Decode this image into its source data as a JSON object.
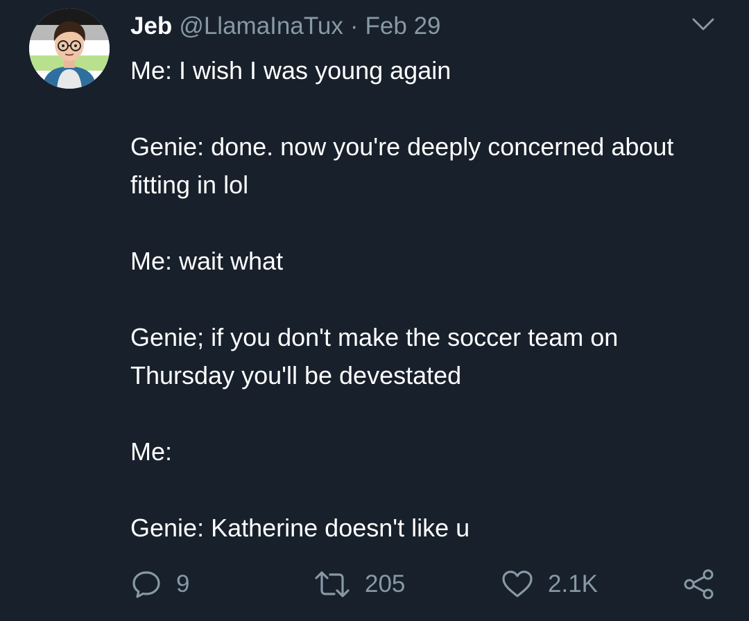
{
  "tweet": {
    "author": {
      "display_name": "Jeb",
      "handle": "@LlamaInaTux"
    },
    "separator": "·",
    "date": "Feb 29",
    "paragraphs": [
      "Me: I wish I was young again",
      "Genie: done. now you're deeply concerned about fitting in lol",
      "Me: wait what",
      "Genie; if you don't make the soccer team on Thursday you'll be devestated",
      "Me:",
      "Genie: Katherine doesn't like u"
    ]
  },
  "actions": {
    "reply": {
      "icon": "reply-icon",
      "count": "9"
    },
    "retweet": {
      "icon": "retweet-icon",
      "count": "205"
    },
    "like": {
      "icon": "heart-icon",
      "count": "2.1K"
    },
    "share": {
      "icon": "share-icon"
    },
    "menu": {
      "icon": "chevron-down-icon"
    }
  },
  "colors": {
    "background": "#17202b",
    "text": "#ffffff",
    "secondary_text": "#8899a6"
  }
}
